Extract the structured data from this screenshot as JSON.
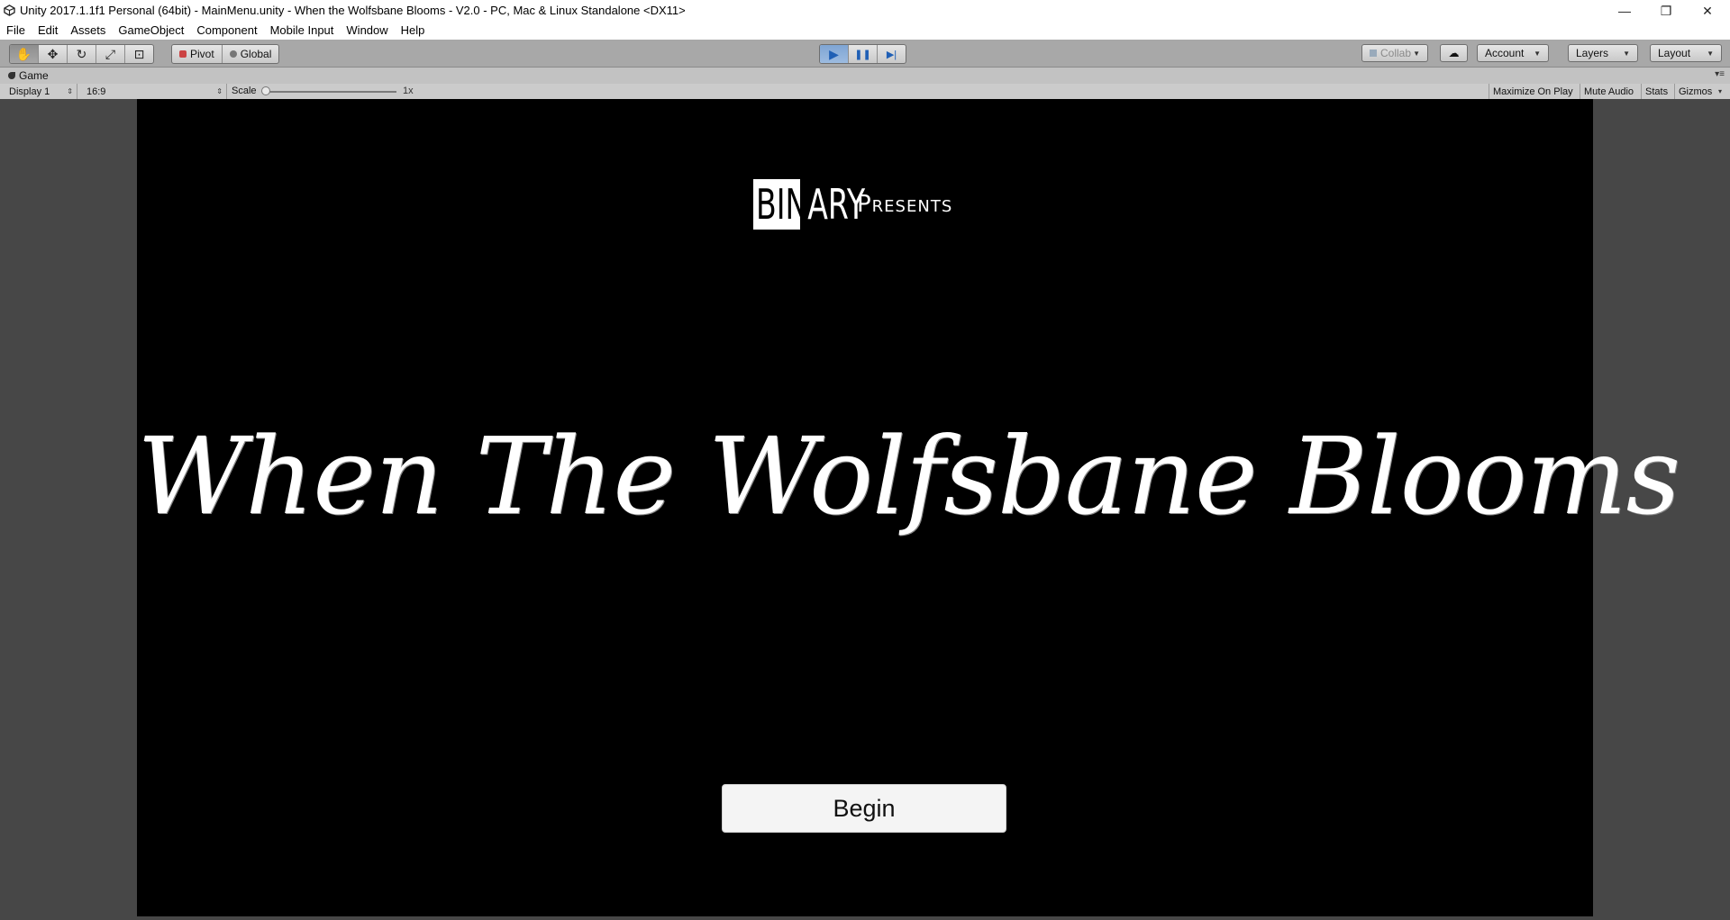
{
  "window": {
    "title": "Unity 2017.1.1f1 Personal (64bit) - MainMenu.unity - When the Wolfsbane Blooms - V2.0 - PC, Mac & Linux Standalone <DX11>",
    "minimize_glyph": "—",
    "maximize_glyph": "❐",
    "close_glyph": "✕"
  },
  "menu": [
    "File",
    "Edit",
    "Assets",
    "GameObject",
    "Component",
    "Mobile Input",
    "Window",
    "Help"
  ],
  "toolbar": {
    "tools": [
      {
        "name": "hand-tool",
        "glyph": "✋"
      },
      {
        "name": "move-tool",
        "glyph": "✥"
      },
      {
        "name": "rotate-tool",
        "glyph": "↻"
      },
      {
        "name": "scale-tool",
        "glyph": "⤢"
      },
      {
        "name": "rect-tool",
        "glyph": "⊡"
      }
    ],
    "pivot_label": "Pivot",
    "global_label": "Global",
    "play_glyph": "▶",
    "pause_glyph": "❚❚",
    "step_glyph": "▶|",
    "collab_label": "Collab",
    "cloud_glyph": "☁",
    "account_label": "Account",
    "layers_label": "Layers",
    "layout_label": "Layout",
    "caret": "▼"
  },
  "game_tab": {
    "label": "Game",
    "display": "Display 1",
    "aspect": "16:9",
    "scale_label": "Scale",
    "scale_value": "1x",
    "maximize_on_play": "Maximize On Play",
    "mute_audio": "Mute Audio",
    "stats": "Stats",
    "gizmos": "Gizmos"
  },
  "game": {
    "logo_dark": "BIN",
    "logo_light": "ARY",
    "presents": "Presents",
    "title": "When The Wolfsbane Blooms",
    "begin_label": "Begin"
  },
  "colors": {
    "toolbar_bg": "#a8a8a8",
    "play_active": "#7fa5d4",
    "game_bg": "#000000",
    "editor_gutter": "#474747"
  }
}
